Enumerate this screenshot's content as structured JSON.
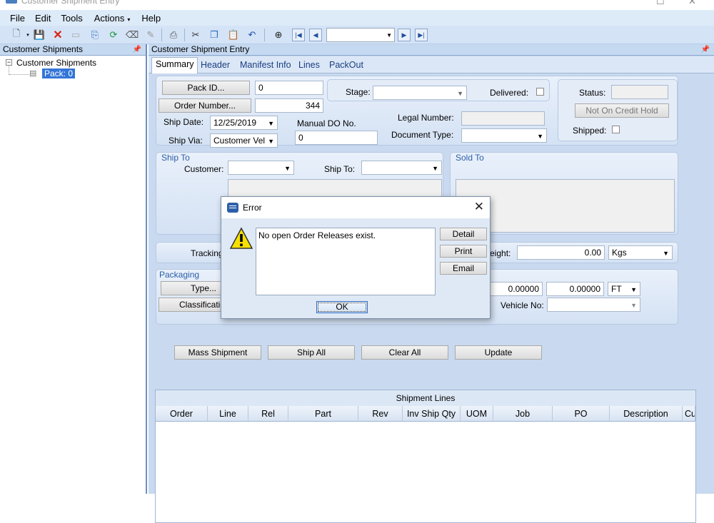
{
  "window": {
    "title": "Customer Shipment Entry"
  },
  "menu": [
    "File",
    "Edit",
    "Tools",
    "Actions",
    "Help"
  ],
  "left_pane": {
    "title": "Customer Shipments",
    "root": "Customer Shipments",
    "child": "Pack: 0"
  },
  "right_pane": {
    "title": "Customer Shipment Entry"
  },
  "tabs": [
    "Summary",
    "Header",
    "Manifest Info",
    "Lines",
    "PackOut"
  ],
  "form": {
    "pack_id_btn": "Pack ID...",
    "pack_id_value": "0",
    "order_btn": "Order Number...",
    "order_value": "344",
    "ship_date_label": "Ship Date:",
    "ship_date_value": "12/25/2019",
    "ship_via_label": "Ship Via:",
    "ship_via_value": "Customer Vel",
    "manual_do_label": "Manual DO No.",
    "manual_do_value": "0",
    "stage_label": "Stage:",
    "delivered_label": "Delivered:",
    "legal_number_label": "Legal Number:",
    "document_type_label": "Document Type:",
    "status_label": "Status:",
    "credit_hold_btn": "Not On Credit Hold",
    "shipped_label": "Shipped:",
    "ship_to_group": "Ship To",
    "customer_label": "Customer:",
    "ship_to_label": "Ship To:",
    "sold_to_group": "Sold To",
    "tracking_label": "Tracking",
    "weight_label": "eight:",
    "weight_value": "0.00",
    "weight_uom": "Kgs",
    "packaging_group": "Packaging",
    "type_btn": "Type...",
    "classification_btn": "Classificatio",
    "dim1": "0.00000",
    "dim2": "0.00000",
    "dim_uom": "FT",
    "vehicle_label": "Vehicle No:"
  },
  "actions": [
    "Mass Shipment",
    "Ship All",
    "Clear All",
    "Update"
  ],
  "grid": {
    "title": "Shipment Lines",
    "columns": [
      "Order",
      "Line",
      "Rel",
      "Part",
      "Rev",
      "Inv Ship Qty",
      "UOM",
      "Job",
      "PO",
      "Description",
      "Cu"
    ]
  },
  "dialog": {
    "title": "Error",
    "message": "No open Order Releases exist.",
    "buttons": [
      "Detail",
      "Print",
      "Email"
    ],
    "ok": "OK"
  }
}
